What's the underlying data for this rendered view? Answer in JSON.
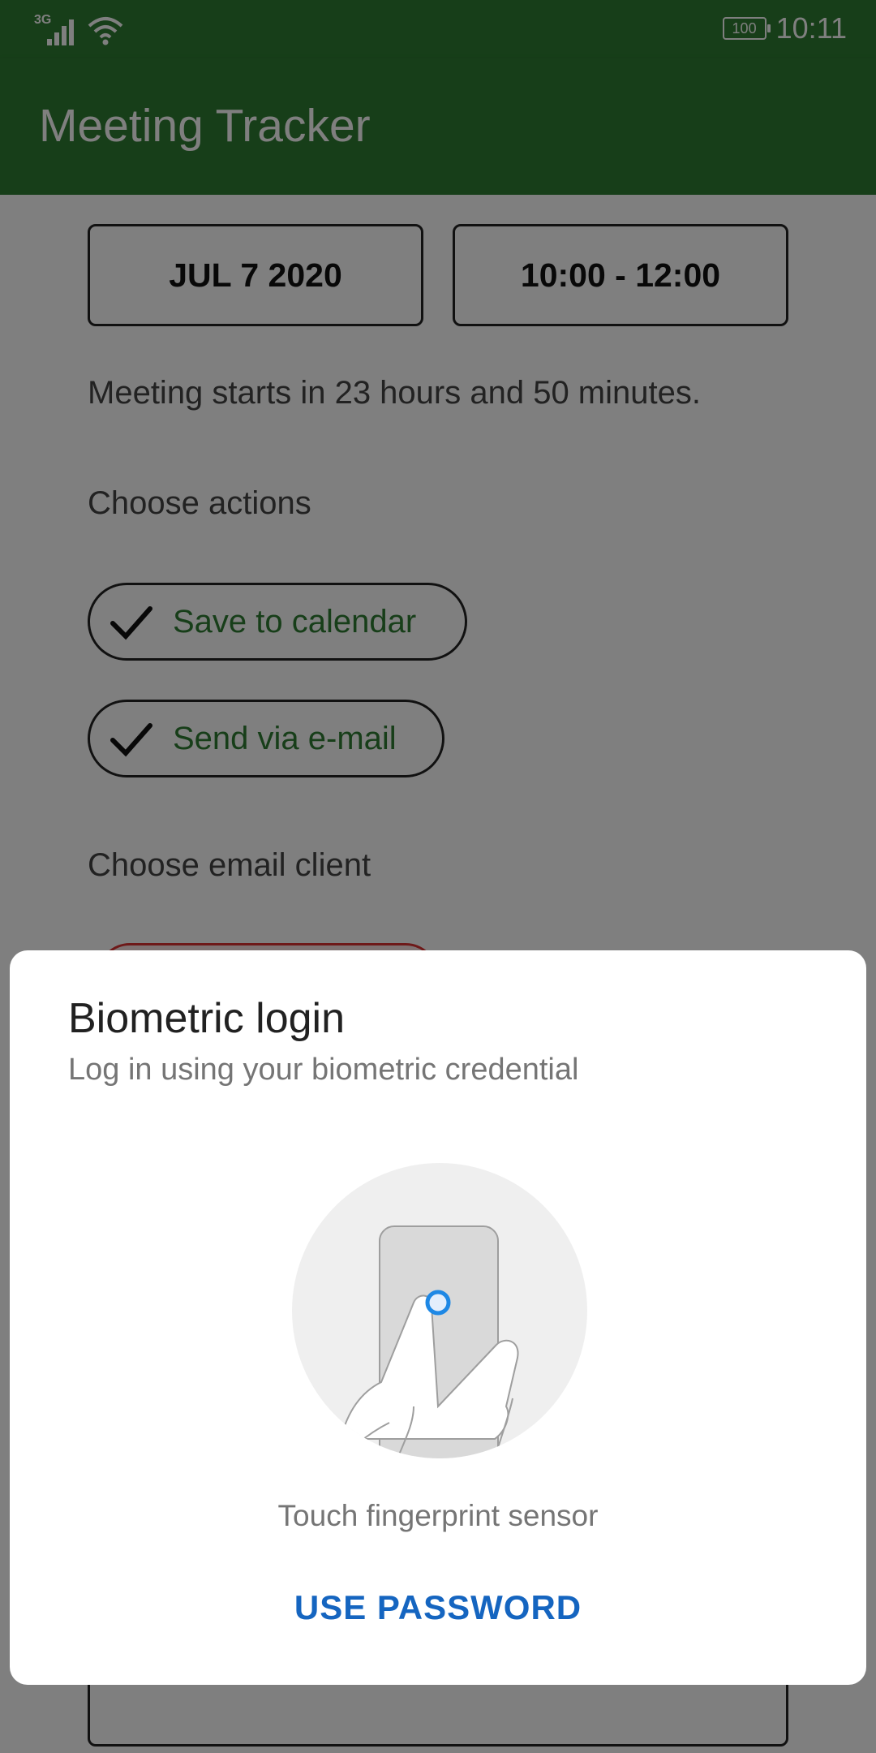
{
  "status_bar": {
    "network_type": "3G",
    "battery_level": "100",
    "time": "10:11",
    "icons": [
      "signal-icon",
      "wifi-icon",
      "battery-icon"
    ]
  },
  "app_bar": {
    "title": "Meeting Tracker"
  },
  "form": {
    "date_button": "JUL 7 2020",
    "time_button": "10:00 - 12:00",
    "countdown_text": "Meeting starts in 23 hours and 50 minutes.",
    "actions_heading": "Choose actions",
    "actions": [
      {
        "label": "Save to calendar",
        "checked": true,
        "icon": "check-icon"
      },
      {
        "label": "Send via e-mail",
        "checked": true,
        "icon": "check-icon"
      }
    ],
    "email_heading": "Choose email client"
  },
  "dialog": {
    "title": "Biometric login",
    "subtitle": "Log in using your biometric credential",
    "illustration_icon": "fingerprint-sensor-illustration",
    "status": "Touch fingerprint sensor",
    "negative_button": "USE PASSWORD"
  },
  "colors": {
    "primary": "#2e7d32",
    "accent_link": "#1565c0",
    "scrim": "rgba(0,0,0,0.5)"
  }
}
